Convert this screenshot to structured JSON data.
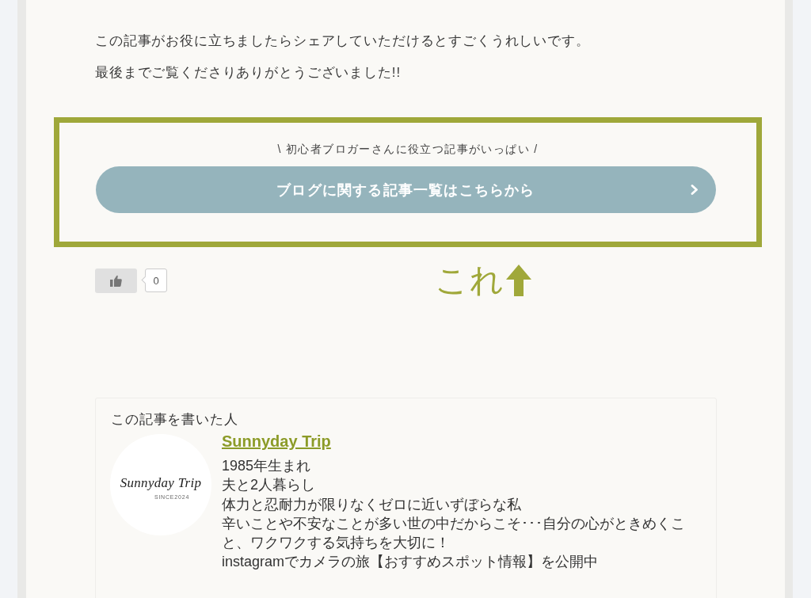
{
  "article_end": {
    "paragraphs": [
      "この記事がお役に立ちましたらシェアしていただけるとすごくうれしいです。",
      "最後までご覧くださりありがとうございました!!"
    ]
  },
  "highlight_box": {
    "caption": "\\ 初心者ブロガーさんに役立つ記事がいっぱい /",
    "button": {
      "label": "ブログに関する記事一覧はこちらから"
    }
  },
  "like": {
    "count": "0"
  },
  "annotation": {
    "text": "これ"
  },
  "author_box": {
    "heading": "この記事を書いた人",
    "avatar": {
      "logo": "Sunnyday Trip",
      "tagline": "SINCE2024"
    },
    "name": "Sunnyday Trip",
    "bio": [
      "1985年生まれ",
      "夫と2人暮らし",
      "体力と忍耐力が限りなくゼロに近いずぼらな私",
      "辛いことや不安なことが多い世の中だからこそ･･･自分の心がときめくこと、ワクワクする気持ちを大切に！",
      "instagramでカメラの旅【おすすめスポット情報】を公開中"
    ]
  }
}
